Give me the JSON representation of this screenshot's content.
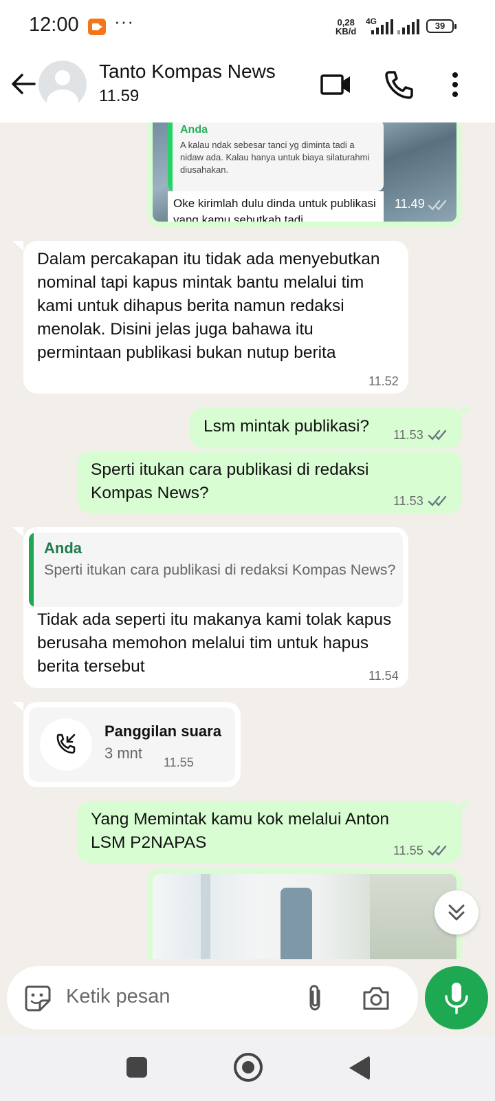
{
  "status_bar": {
    "time": "12:00",
    "dots": "···",
    "speed_value": "0,28",
    "speed_unit": "KB/d",
    "network": "4G",
    "battery": "39",
    "icons": [
      "screen-record-icon",
      "signal-icon",
      "signal-icon",
      "battery-icon"
    ]
  },
  "header": {
    "contact_name": "Tanto Kompas News",
    "last_seen": "11.59",
    "icons": [
      "back-arrow-icon",
      "avatar-icon",
      "video-call-icon",
      "phone-icon",
      "more-vert-icon"
    ]
  },
  "messages": {
    "photo_reply": {
      "quote_author": "Anda",
      "quote_text": "A kalau ndak sebesar tanci yg diminta tadi a nidaw ada. Kalau hanya untuk biaya silaturahmi diusahakan.",
      "reply_text": "Oke kirimlah dulu dinda untuk publikasi yang kamu sebutkah tadi",
      "time": "11.49"
    },
    "msg1": {
      "text": "Dalam percakapan itu tidak ada menyebutkan nominal tapi kapus mintak bantu melalui tim kami untuk dihapus berita namun redaksi menolak. Disini jelas juga bahawa itu permintaan publikasi bukan nutup berita",
      "time": "11.52"
    },
    "msg2": {
      "text": "Lsm mintak publikasi?",
      "time": "11.53"
    },
    "msg3": {
      "text": "Sperti itukan cara publikasi di redaksi Kompas News?",
      "time": "11.53"
    },
    "msg4": {
      "quote_author": "Anda",
      "quote_text": "Sperti itukan cara publikasi di redaksi Kompas News?",
      "text": "Tidak ada seperti itu makanya kami tolak kapus berusaha memohon melalui tim untuk hapus berita tersebut",
      "time": "11.54"
    },
    "call": {
      "title": "Panggilan suara",
      "duration": "3 mnt",
      "time": "11.55"
    },
    "msg5": {
      "text": "Yang Memintak kamu kok melalui Anton LSM P2NAPAS",
      "time": "11.55"
    }
  },
  "input": {
    "placeholder": "Ketik pesan"
  },
  "colors": {
    "chat_bg": "#f2efea",
    "outgoing": "#d9fdd3",
    "incoming": "#ffffff",
    "accent_green": "#1da851",
    "quote_green": "#1f7a4d"
  }
}
